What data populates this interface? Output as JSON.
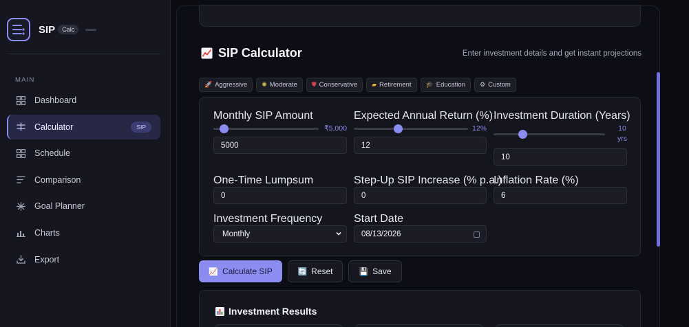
{
  "brand": {
    "name": "SIP",
    "badge": "Calc"
  },
  "sidebar": {
    "section_label": "MAIN",
    "items": [
      {
        "label": "Dashboard",
        "icon": "grid-icon"
      },
      {
        "label": "Calculator",
        "icon": "sliders-icon",
        "badge": "SIP",
        "active": true
      },
      {
        "label": "Schedule",
        "icon": "grid-icon"
      },
      {
        "label": "Comparison",
        "icon": "lines-icon"
      },
      {
        "label": "Goal Planner",
        "icon": "sparkle-icon"
      },
      {
        "label": "Charts",
        "icon": "bar-chart-icon"
      },
      {
        "label": "Export",
        "icon": "download-icon"
      }
    ]
  },
  "header": {
    "title": "SIP Calculator",
    "subtitle": "Enter investment details and get instant projections"
  },
  "presets": [
    {
      "label": "Aggressive",
      "icon": "rocket-icon"
    },
    {
      "label": "Moderate",
      "icon": "sun-icon"
    },
    {
      "label": "Conservative",
      "icon": "shield-icon"
    },
    {
      "label": "Retirement",
      "icon": "beach-icon"
    },
    {
      "label": "Education",
      "icon": "cap-icon"
    },
    {
      "label": "Custom",
      "icon": "gear-icon"
    }
  ],
  "form": {
    "monthly_sip": {
      "label": "Monthly SIP Amount",
      "display": "₹5,000",
      "value": "5000",
      "slider_fraction": 0.1
    },
    "annual_return": {
      "label": "Expected Annual Return (%)",
      "display": "12%",
      "value": "12",
      "slider_fraction": 0.39
    },
    "duration": {
      "label": "Investment Duration (Years)",
      "display_num": "10",
      "display_unit": "yrs",
      "value": "10",
      "slider_fraction": 0.26
    },
    "lumpsum": {
      "label": "One-Time Lumpsum",
      "value": "0"
    },
    "step_up": {
      "label": "Step-Up SIP Increase (% p.a.)",
      "value": "0"
    },
    "inflation": {
      "label": "Inflation Rate (%)",
      "value": "6"
    },
    "frequency": {
      "label": "Investment Frequency",
      "value": "Monthly"
    },
    "start_date": {
      "label": "Start Date",
      "value": "08/13/2026"
    }
  },
  "actions": {
    "calculate": "Calculate SIP",
    "reset": "Reset",
    "save": "Save"
  },
  "results": {
    "title": "Investment Results"
  },
  "colors": {
    "accent": "#8b8cf0",
    "background": "#0b0c12",
    "sidebar": "#15161f"
  }
}
